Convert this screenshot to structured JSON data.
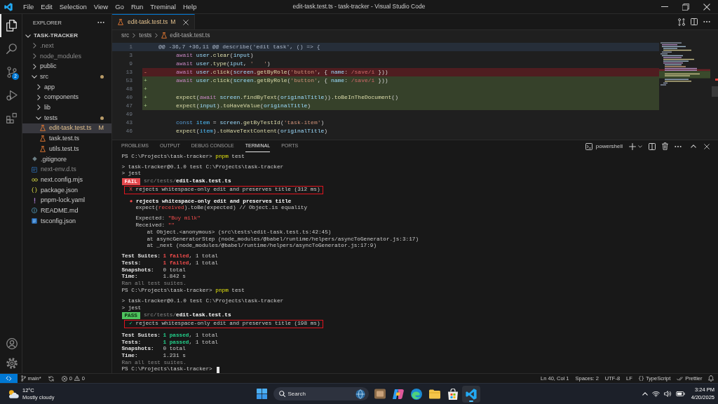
{
  "window": {
    "title": "edit-task.test.ts - task-tracker - Visual Studio Code"
  },
  "menu": [
    "File",
    "Edit",
    "Selection",
    "View",
    "Go",
    "Run",
    "Treminal",
    "Help"
  ],
  "activity_bar": {
    "top": [
      {
        "kind": "explorer",
        "selected": true
      },
      {
        "kind": "search",
        "selected": false
      },
      {
        "kind": "source-control",
        "selected": false,
        "badge": "2"
      },
      {
        "kind": "run-debug",
        "selected": false
      },
      {
        "kind": "extensions",
        "selected": false
      }
    ],
    "bottom": [
      {
        "kind": "account"
      },
      {
        "kind": "settings"
      }
    ]
  },
  "sidebar": {
    "title": "EXPLORER",
    "tree": {
      "root": "TASK-TRACKER",
      "expanded": true,
      "items": [
        {
          "name": ".next",
          "kind": "folder",
          "expanded": false,
          "selected": false,
          "dimmed": true,
          "modified": false
        },
        {
          "name": "node_modules",
          "kind": "folder",
          "expanded": false,
          "selected": false,
          "dimmed": true,
          "modified": false
        },
        {
          "name": "public",
          "kind": "folder",
          "expanded": false,
          "selected": false,
          "dimmed": false,
          "modified": false
        },
        {
          "name": "src",
          "kind": "folder",
          "expanded": true,
          "selected": false,
          "dimmed": false,
          "modified": true,
          "children": [
            {
              "name": "app",
              "kind": "folder",
              "expanded": false,
              "selected": false,
              "dimmed": false,
              "modified": false
            },
            {
              "name": "components",
              "kind": "folder",
              "expanded": false,
              "selected": false,
              "dimmed": false,
              "modified": false
            },
            {
              "name": "lib",
              "kind": "folder",
              "expanded": false,
              "selected": false,
              "dimmed": false,
              "modified": false
            },
            {
              "name": "tests",
              "kind": "folder",
              "expanded": true,
              "selected": false,
              "dimmed": false,
              "modified": true,
              "children": [
                {
                  "name": "edit-task.test.ts",
                  "kind": "test",
                  "selected": true,
                  "dimmed": false,
                  "modified": true,
                  "git_status": "M"
                },
                {
                  "name": "task.test.ts",
                  "kind": "test",
                  "selected": false,
                  "dimmed": false,
                  "modified": false
                },
                {
                  "name": "utils.test.ts",
                  "kind": "test",
                  "selected": false,
                  "dimmed": false,
                  "modified": false
                }
              ]
            }
          ]
        },
        {
          "name": ".gitignore",
          "kind": "gitignore",
          "selected": false,
          "dimmed": false,
          "modified": false
        },
        {
          "name": "next-env.d.ts",
          "kind": "typescript",
          "selected": false,
          "dimmed": true,
          "modified": false
        },
        {
          "name": "next.config.mjs",
          "kind": "javascript",
          "selected": false,
          "dimmed": false,
          "modified": false
        },
        {
          "name": "package.json",
          "kind": "package",
          "selected": false,
          "dimmed": false,
          "modified": false
        },
        {
          "name": "pnpm-lock.yaml",
          "kind": "yaml",
          "selected": false,
          "dimmed": false,
          "modified": false
        },
        {
          "name": "README.md",
          "kind": "markdown",
          "selected": false,
          "dimmed": false,
          "modified": false
        },
        {
          "name": "tsconfig.json",
          "kind": "tsconfig",
          "selected": false,
          "dimmed": false,
          "modified": false
        }
      ]
    }
  },
  "editor": {
    "tabs": [
      {
        "label": "edit-task.test.ts",
        "kind": "test",
        "selected": true,
        "modified": true,
        "git_status": "M"
      }
    ],
    "breadcrumbs": [
      {
        "label": "src",
        "kind": "folder"
      },
      {
        "label": "tests",
        "kind": "folder"
      },
      {
        "label": "edit-task.test.ts",
        "kind": "test"
      }
    ],
    "lines": [
      {
        "number": "1",
        "kind": "hunk",
        "tokens": [
          {
            "text": "@@ -36,7 +36,11 @@ describe('edit task', () => {",
            "kind": "meta"
          }
        ]
      },
      {
        "number": "3",
        "kind": "context",
        "tokens": [
          {
            "text": "await",
            "kind": "keyword"
          },
          {
            "text": " user",
            "kind": "variable"
          },
          {
            "text": ".",
            "kind": "plain"
          },
          {
            "text": "clear",
            "kind": "function"
          },
          {
            "text": "(",
            "kind": "plain"
          },
          {
            "text": "input",
            "kind": "variable"
          },
          {
            "text": ")",
            "kind": "plain"
          }
        ]
      },
      {
        "number": "9",
        "kind": "context",
        "tokens": [
          {
            "text": "await",
            "kind": "keyword"
          },
          {
            "text": " user",
            "kind": "variable"
          },
          {
            "text": ".",
            "kind": "plain"
          },
          {
            "text": "type",
            "kind": "function"
          },
          {
            "text": "(",
            "kind": "plain"
          },
          {
            "text": "iput",
            "kind": "variable"
          },
          {
            "text": ", ",
            "kind": "plain"
          },
          {
            "text": "'   '",
            "kind": "string"
          },
          {
            "text": ")",
            "kind": "plain"
          }
        ]
      },
      {
        "number": "13",
        "kind": "removed",
        "marker": "-",
        "tokens": [
          {
            "text": "await",
            "kind": "keyword"
          },
          {
            "text": " user",
            "kind": "variable"
          },
          {
            "text": ".",
            "kind": "plain"
          },
          {
            "text": "click",
            "kind": "function"
          },
          {
            "text": "(",
            "kind": "plain"
          },
          {
            "text": "screen",
            "kind": "variable"
          },
          {
            "text": ".",
            "kind": "plain"
          },
          {
            "text": "getByRole",
            "kind": "function"
          },
          {
            "text": "(",
            "kind": "plain"
          },
          {
            "text": "'button'",
            "kind": "string"
          },
          {
            "text": ", { ",
            "kind": "plain"
          },
          {
            "text": "name",
            "kind": "variable"
          },
          {
            "text": ": ",
            "kind": "plain"
          },
          {
            "text": "/save/i",
            "kind": "regex"
          },
          {
            "text": " }))",
            "kind": "plain"
          }
        ]
      },
      {
        "number": "53",
        "kind": "added",
        "marker": "+",
        "tokens": [
          {
            "text": "await",
            "kind": "keyword"
          },
          {
            "text": " user",
            "kind": "variable"
          },
          {
            "text": ".",
            "kind": "plain"
          },
          {
            "text": "click",
            "kind": "function"
          },
          {
            "text": "(",
            "kind": "plain"
          },
          {
            "text": "screen",
            "kind": "variable"
          },
          {
            "text": ".",
            "kind": "plain"
          },
          {
            "text": "getByRole",
            "kind": "function"
          },
          {
            "text": "(",
            "kind": "plain"
          },
          {
            "text": "'button'",
            "kind": "string"
          },
          {
            "text": ", { ",
            "kind": "plain"
          },
          {
            "text": "name",
            "kind": "variable"
          },
          {
            "text": ": ",
            "kind": "plain"
          },
          {
            "text": "/save/i",
            "kind": "regex"
          },
          {
            "text": " }))",
            "kind": "plain"
          }
        ]
      },
      {
        "number": "48",
        "kind": "added",
        "marker": "+"
      },
      {
        "number": "40",
        "kind": "added",
        "marker": "+",
        "tokens": [
          {
            "text": "expect",
            "kind": "function"
          },
          {
            "text": "(",
            "kind": "plain"
          },
          {
            "text": "await",
            "kind": "keyword"
          },
          {
            "text": " screen",
            "kind": "variable"
          },
          {
            "text": ".",
            "kind": "plain"
          },
          {
            "text": "findByText",
            "kind": "function"
          },
          {
            "text": "(",
            "kind": "plain"
          },
          {
            "text": "originalTitle",
            "kind": "variable"
          },
          {
            "text": ")).",
            "kind": "plain"
          },
          {
            "text": "toBeInTheDocument",
            "kind": "function"
          },
          {
            "text": "()",
            "kind": "plain"
          }
        ]
      },
      {
        "number": "47",
        "kind": "added",
        "marker": "+",
        "tokens": [
          {
            "text": "expect",
            "kind": "function"
          },
          {
            "text": "(",
            "kind": "plain"
          },
          {
            "text": "input",
            "kind": "variable"
          },
          {
            "text": ").",
            "kind": "plain"
          },
          {
            "text": "toHaveValue",
            "kind": "function"
          },
          {
            "text": "(",
            "kind": "plain"
          },
          {
            "text": "originalTitle",
            "kind": "variable"
          },
          {
            "text": ")",
            "kind": "plain"
          }
        ]
      },
      {
        "number": "49",
        "kind": "context"
      },
      {
        "number": "43",
        "kind": "context",
        "tokens": [
          {
            "text": "const",
            "kind": "storage"
          },
          {
            "text": " item",
            "kind": "constant"
          },
          {
            "text": " = ",
            "kind": "plain"
          },
          {
            "text": "screen",
            "kind": "variable"
          },
          {
            "text": ".",
            "kind": "plain"
          },
          {
            "text": "getByTestId",
            "kind": "function"
          },
          {
            "text": "(",
            "kind": "plain"
          },
          {
            "text": "'task-item'",
            "kind": "string"
          },
          {
            "text": ")",
            "kind": "plain"
          }
        ]
      },
      {
        "number": "46",
        "kind": "context",
        "tokens": [
          {
            "text": "expect",
            "kind": "function"
          },
          {
            "text": "(",
            "kind": "plain"
          },
          {
            "text": "item",
            "kind": "constant"
          },
          {
            "text": ").",
            "kind": "plain"
          },
          {
            "text": "toHaveTextContent",
            "kind": "function"
          },
          {
            "text": "(",
            "kind": "plain"
          },
          {
            "text": "originalTitle",
            "kind": "variable"
          },
          {
            "text": ")",
            "kind": "plain"
          }
        ]
      }
    ]
  },
  "panel": {
    "tabs": [
      {
        "label": "PROBLEMS",
        "selected": false
      },
      {
        "label": "OUTPUT",
        "selected": false
      },
      {
        "label": "DEBUG CONSOLE",
        "selected": false
      },
      {
        "label": "TERMINAL",
        "selected": true
      },
      {
        "label": "PORTS",
        "selected": false
      }
    ],
    "terminal_name": "powershell",
    "terminal": [
      {
        "kind": "prompt",
        "segments": [
          {
            "text": "PS C:\\Projects\\task-tracker> ",
            "kind": "plain"
          },
          {
            "text": "pnpm",
            "kind": "command"
          },
          {
            "text": " test",
            "kind": "plain"
          }
        ]
      },
      {
        "kind": "blank"
      },
      {
        "kind": "output",
        "segments": [
          {
            "text": "> task-tracker@0.1.0 test C:\\Projects\\task-tracker",
            "kind": "plain"
          }
        ]
      },
      {
        "kind": "output",
        "segments": [
          {
            "text": "> jest",
            "kind": "plain"
          }
        ]
      },
      {
        "kind": "status",
        "segments": [
          {
            "text": "FAIL",
            "kind": "fail-badge"
          },
          {
            "text": "src/tests/",
            "kind": "dim"
          },
          {
            "text": "edit-task.test.ts",
            "kind": "strong"
          }
        ]
      },
      {
        "kind": "result",
        "highlighted": true,
        "segments": [
          {
            "text": "X",
            "kind": "fail"
          },
          {
            "text": " rejects whitespace-only edit and preserves title (312 ms)",
            "kind": "plain"
          }
        ]
      },
      {
        "kind": "blank"
      },
      {
        "kind": "heading",
        "segments": [
          {
            "text": "●",
            "kind": "fail"
          },
          {
            "text": " rejects whitespace-only edit and preserves title",
            "kind": "strong"
          }
        ]
      },
      {
        "kind": "detail",
        "segments": [
          {
            "text": "expect(",
            "kind": "plain"
          },
          {
            "text": "received",
            "kind": "fail"
          },
          {
            "text": ").toBe(expected) // Object.is equality",
            "kind": "plain"
          }
        ]
      },
      {
        "kind": "blank"
      },
      {
        "kind": "detail",
        "segments": [
          {
            "text": "Expected: ",
            "kind": "plain"
          },
          {
            "text": "\"Buy milk\"",
            "kind": "fail"
          }
        ]
      },
      {
        "kind": "detail",
        "segments": [
          {
            "text": "Received: ",
            "kind": "plain"
          },
          {
            "text": "\"\"",
            "kind": "fail"
          }
        ]
      },
      {
        "kind": "stack",
        "segments": [
          {
            "text": "at Object.<anonymous> (src\\tests\\edit-task.test.ts:42:45)",
            "kind": "plain"
          }
        ]
      },
      {
        "kind": "stack",
        "segments": [
          {
            "text": "at asyncGeneratorStep (node_modules/@babel/runtime/helpers/asyncToGenerator.js:3:17)",
            "kind": "plain"
          }
        ]
      },
      {
        "kind": "stack",
        "segments": [
          {
            "text": "at _next (node_modules/@babel/runtime/helpers/asyncToGenerator.js:17:9)",
            "kind": "plain"
          }
        ]
      },
      {
        "kind": "blank"
      },
      {
        "kind": "summary",
        "label": "Test Suites:",
        "segments": [
          {
            "text": "1 failed",
            "kind": "fail-strong"
          },
          {
            "text": ", 1 total",
            "kind": "plain"
          }
        ]
      },
      {
        "kind": "summary",
        "label": "Tests:",
        "segments": [
          {
            "text": "1 failed",
            "kind": "fail-strong"
          },
          {
            "text": ", 1 total",
            "kind": "plain"
          }
        ]
      },
      {
        "kind": "summary",
        "label": "Snapshots:",
        "segments": [
          {
            "text": "0 total",
            "kind": "plain"
          }
        ]
      },
      {
        "kind": "summary",
        "label": "Time:",
        "segments": [
          {
            "text": "1.842 s",
            "kind": "plain"
          }
        ]
      },
      {
        "kind": "output",
        "segments": [
          {
            "text": "Ran all test suites.",
            "kind": "dim"
          }
        ]
      },
      {
        "kind": "prompt",
        "segments": [
          {
            "text": "PS C:\\Projects\\task-tracker> ",
            "kind": "plain"
          },
          {
            "text": "pnpm",
            "kind": "command"
          },
          {
            "text": " test",
            "kind": "plain"
          }
        ]
      },
      {
        "kind": "blank"
      },
      {
        "kind": "output",
        "segments": [
          {
            "text": "> task-tracker@0.1.0 test C:\\Projects\\task-tracker",
            "kind": "plain"
          }
        ]
      },
      {
        "kind": "output",
        "segments": [
          {
            "text": "> jest",
            "kind": "plain"
          }
        ]
      },
      {
        "kind": "status",
        "segments": [
          {
            "text": "PASS",
            "kind": "pass-badge"
          },
          {
            "text": "src/tests/",
            "kind": "dim"
          },
          {
            "text": "edit-task.test.ts",
            "kind": "strong"
          }
        ]
      },
      {
        "kind": "result",
        "highlighted": true,
        "segments": [
          {
            "text": "✓",
            "kind": "pass"
          },
          {
            "text": " rejects whitespace-only edit and preserves title (198 ms)",
            "kind": "plain"
          }
        ]
      },
      {
        "kind": "blank"
      },
      {
        "kind": "summary",
        "label": "Test Suites:",
        "segments": [
          {
            "text": "1 passed",
            "kind": "pass-strong"
          },
          {
            "text": ", 1 total",
            "kind": "plain"
          }
        ]
      },
      {
        "kind": "summary",
        "label": "Tests:",
        "segments": [
          {
            "text": "1 passed",
            "kind": "pass-strong"
          },
          {
            "text": ", 1 total",
            "kind": "plain"
          }
        ]
      },
      {
        "kind": "summary",
        "label": "Snapshots:",
        "segments": [
          {
            "text": "0 total",
            "kind": "plain"
          }
        ]
      },
      {
        "kind": "summary",
        "label": "Time:",
        "segments": [
          {
            "text": "1.231 s",
            "kind": "plain"
          }
        ]
      },
      {
        "kind": "output",
        "segments": [
          {
            "text": "Ran all test suites.",
            "kind": "dim"
          }
        ]
      },
      {
        "kind": "prompt",
        "cursor": true,
        "segments": [
          {
            "text": "PS C:\\Projects\\task-tracker>",
            "kind": "plain"
          }
        ]
      }
    ]
  },
  "status_bar": {
    "branch": "main*",
    "errors": "0",
    "warnings": "0",
    "items": [
      {
        "kind": "text",
        "label": "Ln 40, Col 1"
      },
      {
        "kind": "text",
        "label": "Spaces: 2"
      },
      {
        "kind": "text",
        "label": "UTF-8"
      },
      {
        "kind": "text",
        "label": "LF"
      },
      {
        "kind": "language",
        "label": "TypeScript"
      },
      {
        "kind": "formatter",
        "label": "Prettier"
      },
      {
        "kind": "notifications"
      }
    ]
  },
  "taskbar": {
    "weather": {
      "temperature": "12°C",
      "condition": "Mostly cloudy"
    },
    "search": {
      "placeholder": "Search"
    },
    "apps": [
      {
        "kind": "photos",
        "active": false
      },
      {
        "kind": "assistant",
        "active": false
      },
      {
        "kind": "browser",
        "active": false
      },
      {
        "kind": "files",
        "active": false
      },
      {
        "kind": "store",
        "active": false
      },
      {
        "kind": "editor",
        "active": true
      }
    ],
    "clock": {
      "time": "3:24 PM",
      "date": "4/20/2025"
    }
  }
}
